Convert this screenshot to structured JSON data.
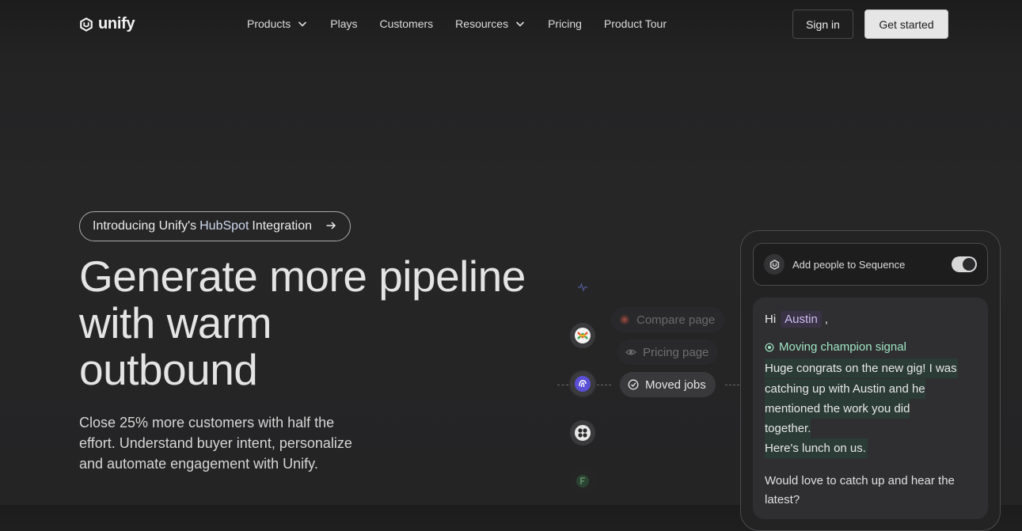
{
  "brand": {
    "name": "unify"
  },
  "nav": {
    "items": [
      {
        "label": "Products",
        "has_dropdown": true
      },
      {
        "label": "Plays",
        "has_dropdown": false
      },
      {
        "label": "Customers",
        "has_dropdown": false
      },
      {
        "label": "Resources",
        "has_dropdown": true
      },
      {
        "label": "Pricing",
        "has_dropdown": false
      },
      {
        "label": "Product Tour",
        "has_dropdown": false
      }
    ],
    "sign_in": "Sign in",
    "get_started": "Get started"
  },
  "hero": {
    "pill": {
      "prefix": "Introducing Unify's",
      "highlight": "HubSpot",
      "suffix": "Integration"
    },
    "headline_lines": [
      "Generate more pipeline",
      "with warm",
      "outbound"
    ],
    "subtext": "Close 25% more customers with half the effort. Understand buyer intent, personalize and automate engagement with Unify."
  },
  "signals": {
    "compare": "Compare page",
    "pricing": "Pricing page",
    "moved": "Moved jobs"
  },
  "card": {
    "sequence_label": "Add people to Sequence",
    "toggle_on": true,
    "greeting": "Hi",
    "name": "Austin",
    "comma": ",",
    "signal_label": "Moving champion signal",
    "highlight_lines": [
      "Huge congrats on the new gig! I was",
      "catching up with Austin and he",
      "mentioned the work you did",
      "together.",
      "Here's lunch on us."
    ],
    "followup": "Would love to catch up and hear the latest?"
  },
  "colors": {
    "background": "#242425",
    "accent_green": "#9fe5c4",
    "name_tag": "#cdbdf0",
    "highlight_bg": "#2b3b35"
  }
}
